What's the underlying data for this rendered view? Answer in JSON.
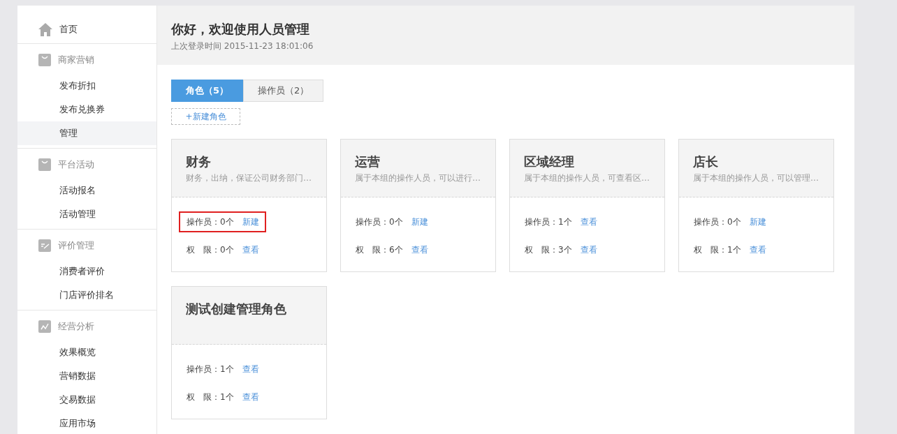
{
  "sidebar": {
    "sections": [
      {
        "label": "首页",
        "kind": "link"
      },
      {
        "label": "商家营销",
        "kind": "group",
        "children": [
          {
            "label": "发布折扣",
            "selected": false
          },
          {
            "label": "发布兑换券",
            "selected": false
          },
          {
            "label": "管理",
            "selected": true
          }
        ]
      },
      {
        "label": "平台活动",
        "kind": "group",
        "children": [
          {
            "label": "活动报名",
            "selected": false
          },
          {
            "label": "活动管理",
            "selected": false
          }
        ]
      },
      {
        "label": "评价管理",
        "kind": "group",
        "children": [
          {
            "label": "消费者评价",
            "selected": false
          },
          {
            "label": "门店评价排名",
            "selected": false
          }
        ]
      },
      {
        "label": "经营分析",
        "kind": "group",
        "children": [
          {
            "label": "效果概览",
            "selected": false
          },
          {
            "label": "营销数据",
            "selected": false
          },
          {
            "label": "交易数据",
            "selected": false
          },
          {
            "label": "应用市场",
            "selected": false
          }
        ]
      }
    ]
  },
  "header": {
    "title": "你好，欢迎使用人员管理",
    "subtitle": "上次登录时间 2015-11-23 18:01:06"
  },
  "tabs": [
    {
      "label": "角色（5）",
      "selected": true
    },
    {
      "label": "操作员（2）",
      "selected": false
    }
  ],
  "new_role_button": "+新建角色",
  "roles": [
    {
      "name": "财务",
      "description": "财务，出纳，保证公司财务部门…",
      "operators": "操作员：0个",
      "operators_link": "新建",
      "operators_highlighted": true,
      "permissions": "权　限：0个",
      "permissions_link": "查看"
    },
    {
      "name": "运营",
      "description": "属于本组的操作人员，可以进行…",
      "operators": "操作员：0个",
      "operators_link": "新建",
      "operators_highlighted": false,
      "permissions": "权　限：6个",
      "permissions_link": "查看"
    },
    {
      "name": "区域经理",
      "description": "属于本组的操作人员，可查看区…",
      "operators": "操作员：1个",
      "operators_link": "查看",
      "operators_highlighted": false,
      "permissions": "权　限：3个",
      "permissions_link": "查看"
    },
    {
      "name": "店长",
      "description": "属于本组的操作人员，可以管理…",
      "operators": "操作员：0个",
      "operators_link": "新建",
      "operators_highlighted": false,
      "permissions": "权　限：1个",
      "permissions_link": "查看"
    },
    {
      "name": "测试创建管理角色",
      "operators": "操作员：1个",
      "operators_link": "查看",
      "operators_highlighted": false,
      "permissions": "权　限：1个",
      "permissions_link": "查看"
    }
  ]
}
